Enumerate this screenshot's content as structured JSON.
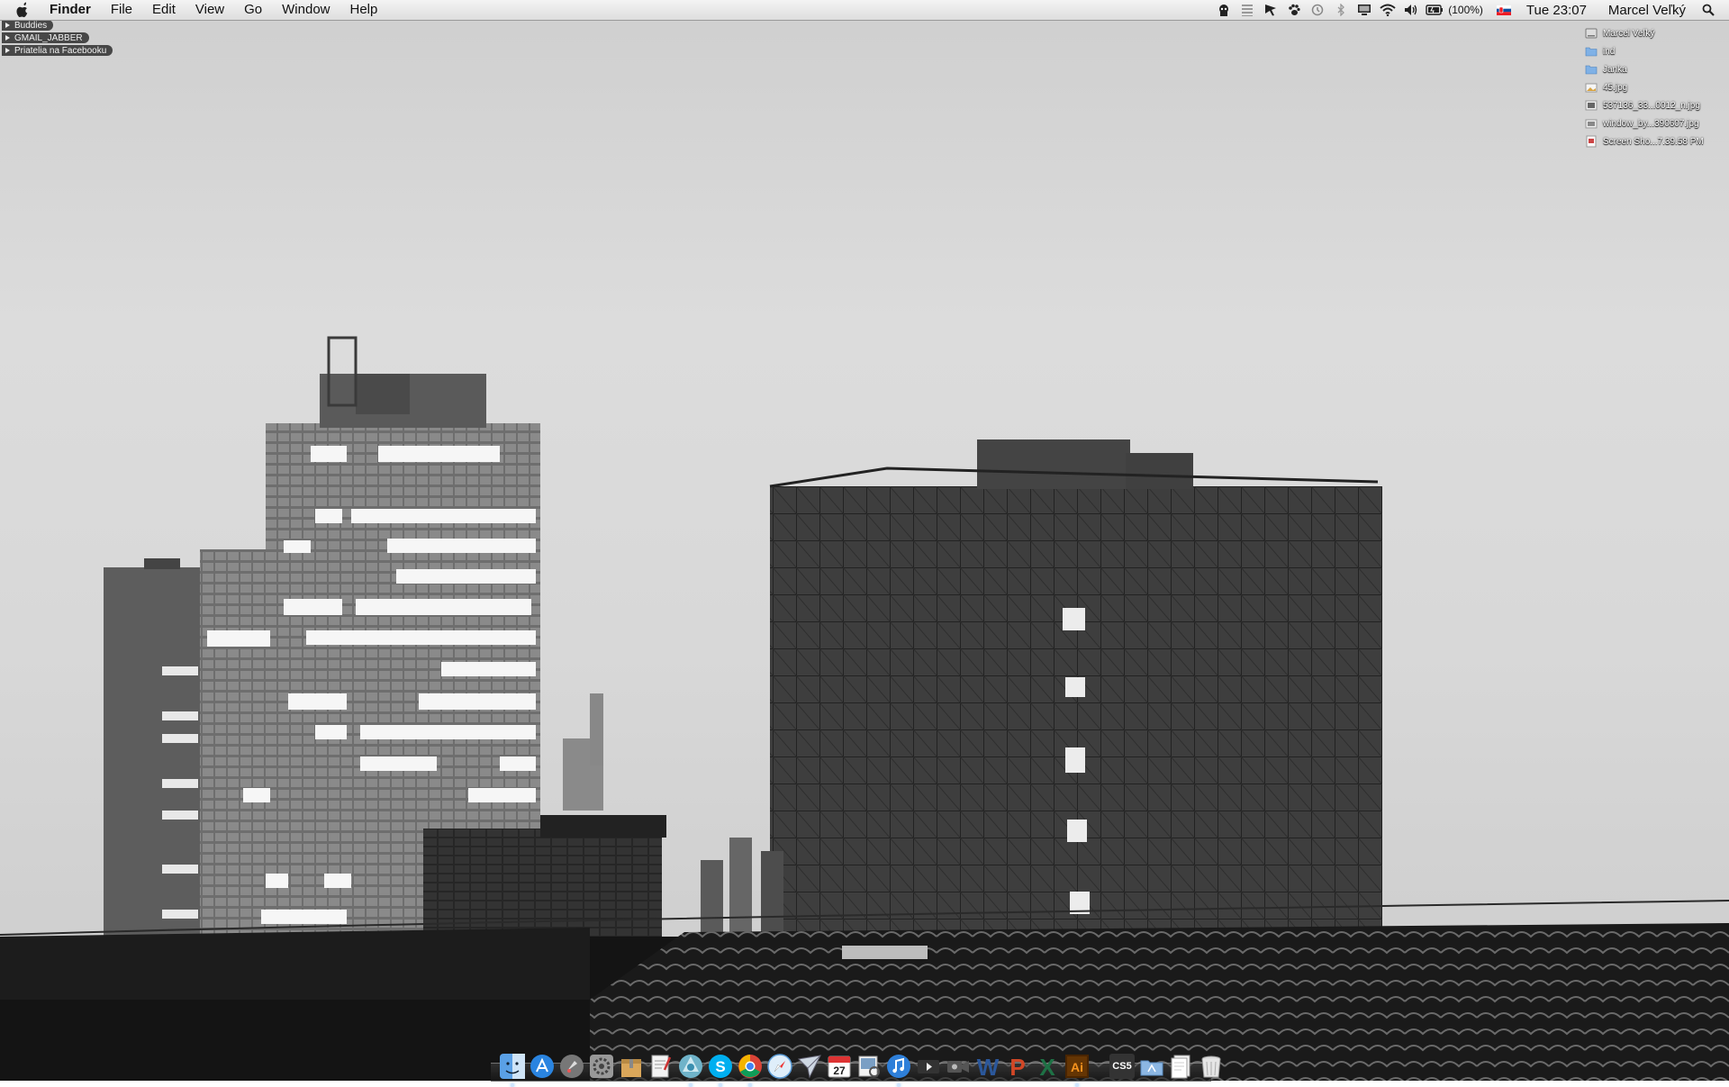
{
  "menubar": {
    "app_name": "Finder",
    "menus": [
      "File",
      "Edit",
      "View",
      "Go",
      "Window",
      "Help"
    ],
    "battery": "(100%)",
    "clock": "Tue 23:07",
    "user": "Marcel Veľký",
    "tray_icons": [
      "alfred-icon",
      "menu-list-icon",
      "cursor-icon",
      "paw-icon",
      "time-machine-icon",
      "bluetooth-icon",
      "display-icon",
      "wifi-icon",
      "volume-icon",
      "battery-icon",
      "flag-sk-icon"
    ]
  },
  "buddy_list": {
    "groups": [
      "Buddies",
      "GMAIL_JABBER",
      "Priatelia na Facebooku"
    ]
  },
  "desktop_items": [
    {
      "label": "Marcel Veľký",
      "icon": "drive-icon"
    },
    {
      "label": "ind",
      "icon": "folder-icon"
    },
    {
      "label": "Janka",
      "icon": "folder-icon"
    },
    {
      "label": "45.jpg",
      "icon": "image-icon"
    },
    {
      "label": "537136_33...0012_n.jpg",
      "icon": "image-icon"
    },
    {
      "label": "window_by...390607.jpg",
      "icon": "image-icon"
    },
    {
      "label": "Screen Sho...7.39.58 PM",
      "icon": "screenshot-icon"
    }
  ],
  "dock": {
    "apps": [
      {
        "name": "finder-icon",
        "running": true
      },
      {
        "name": "app-store-icon",
        "running": false
      },
      {
        "name": "launchpad-icon",
        "running": false
      },
      {
        "name": "system-preferences-icon",
        "running": false
      },
      {
        "name": "archive-utility-icon",
        "running": false
      },
      {
        "name": "script-editor-icon",
        "running": false
      },
      {
        "name": "chrome-alt-icon",
        "running": true
      },
      {
        "name": "skype-icon",
        "running": true
      },
      {
        "name": "chrome-icon",
        "running": true
      },
      {
        "name": "safari-icon",
        "running": false
      },
      {
        "name": "mail-icon",
        "running": false
      },
      {
        "name": "calendar-icon",
        "running": false
      },
      {
        "name": "preview-icon",
        "running": false
      },
      {
        "name": "itunes-icon",
        "running": true
      },
      {
        "name": "dvd-player-icon",
        "running": false
      },
      {
        "name": "facetime-icon",
        "running": false
      },
      {
        "name": "word-icon",
        "running": false
      },
      {
        "name": "powerpoint-icon",
        "running": false
      },
      {
        "name": "excel-icon",
        "running": false
      },
      {
        "name": "illustrator-icon",
        "running": true
      }
    ],
    "calendar_day": "27",
    "word_letter": "W",
    "ppt_letter": "P",
    "excel_letter": "X",
    "illustrator_text": "Ai",
    "cs5_label": "CS5",
    "right_items": [
      "applications-folder-icon",
      "documents-stack-icon",
      "trash-icon"
    ]
  },
  "colors": {
    "illustrator": "#f7931e",
    "skype": "#00aff0",
    "excel": "#1e7145",
    "word": "#2b579a",
    "ppt": "#d24726"
  }
}
